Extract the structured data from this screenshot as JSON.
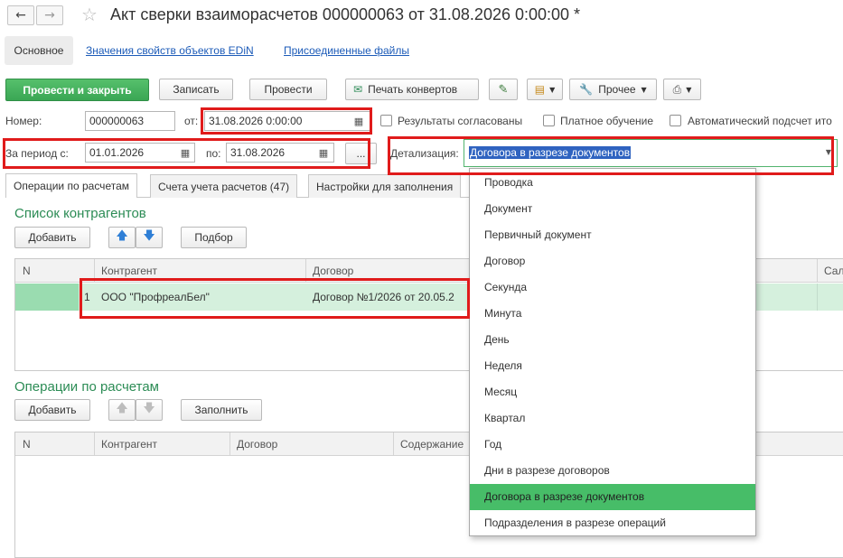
{
  "window": {
    "title": "Акт сверки взаиморасчетов 000000063 от 31.08.2026 0:00:00 *"
  },
  "nav_tabs": {
    "main": "Основное",
    "edin": "Значения свойств объектов EDiN",
    "files": "Присоединенные файлы"
  },
  "toolbar": {
    "post_close": "Провести и закрыть",
    "save": "Записать",
    "post": "Провести",
    "print_envelopes": "Печать конвертов",
    "more": "Прочее"
  },
  "header": {
    "number_label": "Номер:",
    "number_value": "000000063",
    "date_label": "от:",
    "date_value": "31.08.2026  0:00:00",
    "agreed_label": "Результаты согласованы",
    "paid_training_label": "Платное обучение",
    "auto_calc_label": "Автоматический подсчет ито"
  },
  "period": {
    "from_label": "За период с:",
    "from_value": "01.01.2026",
    "to_label": "по:",
    "to_value": "31.08.2026",
    "dots": "...",
    "detail_label": "Детализация:",
    "detail_value": "Договора в разрезе документов"
  },
  "content_tabs": {
    "operations": "Операции по расчетам",
    "accounts": "Счета учета расчетов (47)",
    "settings": "Настройки для заполнения"
  },
  "contractors": {
    "title": "Список контрагентов",
    "add": "Добавить",
    "pick": "Подбор",
    "columns": {
      "n": "N",
      "contractor": "Контрагент",
      "contract": "Договор",
      "cut": "Сал"
    },
    "rows": [
      {
        "n": "1",
        "contractor": "ООО \"ПрофреалБел\"",
        "contract": "Договор №1/2026 от 20.05.2"
      }
    ]
  },
  "operations": {
    "title": "Операции по расчетам",
    "add": "Добавить",
    "fill": "Заполнить",
    "columns": {
      "n": "N",
      "contractor": "Контрагент",
      "contract": "Договор",
      "content": "Содержание"
    }
  },
  "dropdown": {
    "items": [
      "Проводка",
      "Документ",
      "Первичный документ",
      "Договор",
      "Секунда",
      "Минута",
      "День",
      "Неделя",
      "Месяц",
      "Квартал",
      "Год",
      "Дни в разрезе договоров",
      "Договора в разрезе документов",
      "Подразделения в разрезе операций"
    ],
    "selected": "Договора в разрезе документов"
  },
  "colors": {
    "accent_green": "#3aa654",
    "selection_green": "#47bd68",
    "row_green": "#d5f0dd",
    "highlight_red": "#e01b1b",
    "link_blue": "#1c5bb8"
  }
}
